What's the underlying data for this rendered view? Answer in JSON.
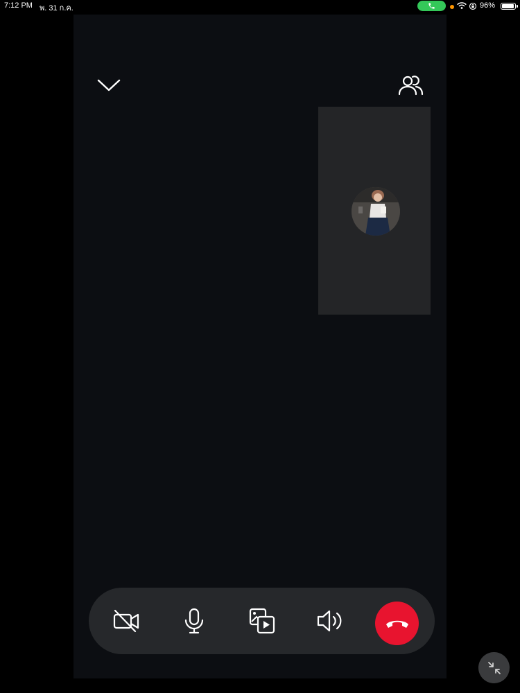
{
  "status_bar": {
    "time": "7:12 PM",
    "date": "พ. 31 ก.ค.",
    "battery_percent": "96%",
    "battery_level": 0.96,
    "call_indicator_color": "#34c759"
  },
  "call": {
    "background_color": "#0c0e12",
    "top_controls": {
      "collapse_icon": "chevron-down-icon",
      "participants_icon": "people-icon"
    },
    "remote_tile": {
      "tile_color": "#242527",
      "avatar_description": "avatar"
    },
    "controls": [
      {
        "name": "camera-off",
        "icon": "video-off-icon"
      },
      {
        "name": "microphone",
        "icon": "microphone-icon"
      },
      {
        "name": "share-media",
        "icon": "media-share-icon"
      },
      {
        "name": "speaker",
        "icon": "speaker-icon"
      },
      {
        "name": "end-call",
        "icon": "phone-hangup-icon",
        "color": "#e8142f"
      }
    ],
    "minimize_icon": "minimize-arrows-icon"
  }
}
